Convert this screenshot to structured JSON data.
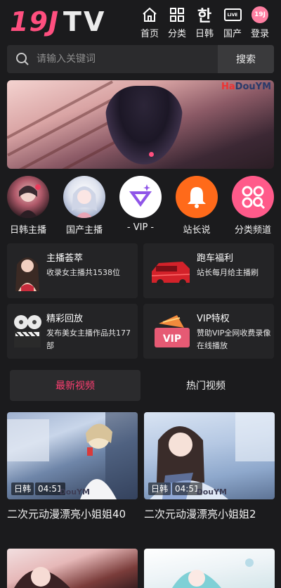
{
  "header": {
    "logo_part1": "19J",
    "logo_part2": "TV",
    "nav": [
      {
        "label": "首页",
        "icon": "home-icon"
      },
      {
        "label": "分类",
        "icon": "grid-icon"
      },
      {
        "label": "日韩",
        "icon": "korean-char-icon",
        "glyph": "한"
      },
      {
        "label": "国产",
        "icon": "live-tv-icon",
        "glyph": "LIVE"
      },
      {
        "label": "登录",
        "icon": "user-logo-icon",
        "glyph": "19J"
      }
    ],
    "accent_color": "#ff4f7f"
  },
  "search": {
    "placeholder": "请输入关键词",
    "button_label": "搜索"
  },
  "banner": {
    "watermark_prefix": "Ha",
    "watermark_main": "DouYM"
  },
  "categories": [
    {
      "label": "日韩主播",
      "icon": "avatar-japan-icon"
    },
    {
      "label": "国产主播",
      "icon": "avatar-china-icon"
    },
    {
      "label": "- VIP -",
      "icon": "vip-diamond-icon"
    },
    {
      "label": "站长说",
      "icon": "bell-icon"
    },
    {
      "label": "分类频道",
      "icon": "category-channel-icon"
    }
  ],
  "features": [
    {
      "title": "主播荟萃",
      "desc": "收录女主播共1538位"
    },
    {
      "title": "跑车福利",
      "desc": "站长每月给主播刷"
    },
    {
      "title": "精彩回放",
      "desc": "发布美女主播作品共177部"
    },
    {
      "title": "VIP特权",
      "desc": "赞助VIP全网收费录像在线播放",
      "badge": "VIP"
    }
  ],
  "tabs": [
    {
      "label": "最新视频",
      "active": true
    },
    {
      "label": "热门视频",
      "active": false
    }
  ],
  "videos": [
    {
      "title": "二次元动漫漂亮小姐姐40",
      "region": "日韩",
      "duration": "04:51",
      "watermark": "DouYM"
    },
    {
      "title": "二次元动漫漂亮小姐姐2",
      "region": "日韩",
      "duration": "04:51",
      "watermark": "DouYM"
    }
  ],
  "colors": {
    "background": "#1b1b1d",
    "active_tab": "#ff3f72",
    "bell": "#ff6a1a",
    "category_pink": "#ff5a8a",
    "vip_purple": "#8f55e8"
  }
}
